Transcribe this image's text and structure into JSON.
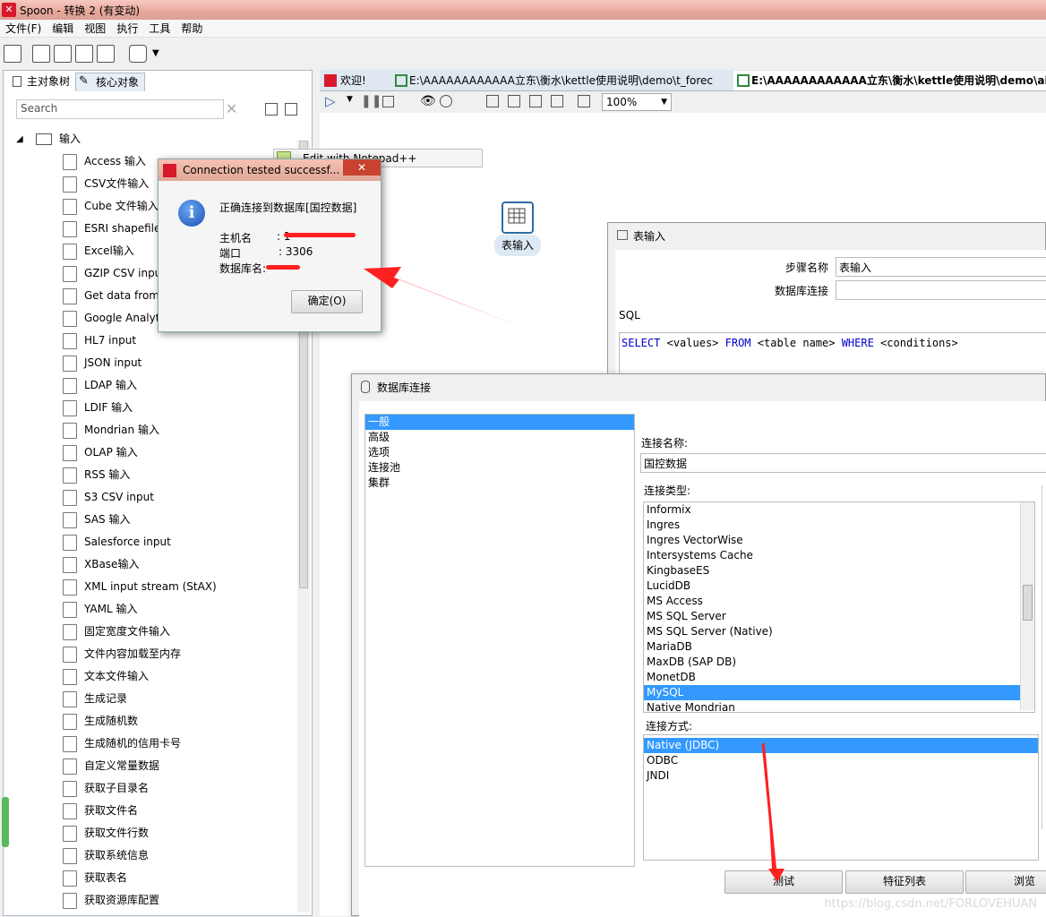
{
  "window": {
    "title": "Spoon - 转换 2 (有变动)"
  },
  "menu": [
    "文件(F)",
    "编辑",
    "视图",
    "执行",
    "工具",
    "帮助"
  ],
  "left_panel": {
    "tabs": [
      "主对象树",
      "核心对象"
    ],
    "search_placeholder": "Search",
    "root_folder": "输入",
    "items": [
      "Access 输入",
      "CSV文件输入",
      "Cube 文件输入",
      "ESRI shapefile",
      "Excel输入",
      "GZIP CSV input",
      "Get data from",
      "Google Analyt",
      "HL7 input",
      "JSON input",
      "LDAP 输入",
      "LDIF 输入",
      "Mondrian 输入",
      "OLAP 输入",
      "RSS 输入",
      "S3 CSV input",
      "SAS 输入",
      "Salesforce input",
      "XBase输入",
      "XML input stream (StAX)",
      "YAML 输入",
      "固定宽度文件输入",
      "文件内容加载至内存",
      "文本文件输入",
      "生成记录",
      "生成随机数",
      "生成随机的信用卡号",
      "自定义常量数据",
      "获取子目录名",
      "获取文件名",
      "获取文件行数",
      "获取系统信息",
      "获取表名",
      "获取资源库配置"
    ]
  },
  "editor": {
    "tabs": [
      "欢迎!",
      "E:\\AAAAAAAAAAAA立东\\衡水\\kettle使用说明\\demo\\t_forec",
      "E:\\AAAAAAAAAAAA立东\\衡水\\kettle使用说明\\demo\\air"
    ],
    "zoom": "100%",
    "step_label": "表输入"
  },
  "context_popup": {
    "label": "Edit with Notepad++"
  },
  "table_input_dialog": {
    "title": "表输入",
    "step_name_label": "步骤名称",
    "step_name_value": "表输入",
    "db_conn_label": "数据库连接",
    "sql_label": "SQL",
    "sql_kw1": "SELECT",
    "sql_t1": "<values>",
    "sql_kw2": "FROM",
    "sql_t2": "<table name>",
    "sql_kw3": "WHERE",
    "sql_t3": "<conditions>"
  },
  "db_dialog": {
    "title": "数据库连接",
    "nav": [
      "一般",
      "高级",
      "选项",
      "连接池",
      "集群"
    ],
    "conn_name_label": "连接名称:",
    "conn_name_value": "国控数据",
    "conn_type_label": "连接类型:",
    "conn_types": [
      "Informix",
      "Ingres",
      "Ingres VectorWise",
      "Intersystems Cache",
      "KingbaseES",
      "LucidDB",
      "MS Access",
      "MS SQL Server",
      "MS SQL Server (Native)",
      "MariaDB",
      "MaxDB (SAP DB)",
      "MonetDB",
      "MySQL",
      "Native Mondrian"
    ],
    "conn_type_selected": "MySQL",
    "access_label": "连接方式:",
    "access_types": [
      "Native (JDBC)",
      "ODBC",
      "JNDI"
    ],
    "access_selected": "Native (JDBC)",
    "buttons": {
      "test": "测试",
      "features": "特征列表",
      "browse": "浏览"
    }
  },
  "success_dialog": {
    "title": "Connection tested successf...",
    "message": "正确连接到数据库[国控数据]",
    "host_label": "主机名",
    "host_value": ": 1",
    "port_label": "端口",
    "port_value": ": 3306",
    "db_label": "数据库名:",
    "ok_button": "确定(O)"
  },
  "watermark": "https://blog.csdn.net/FORLOVEHUAN",
  "colors": {
    "accent": "#3399ff",
    "annotation": "#ff2020"
  }
}
